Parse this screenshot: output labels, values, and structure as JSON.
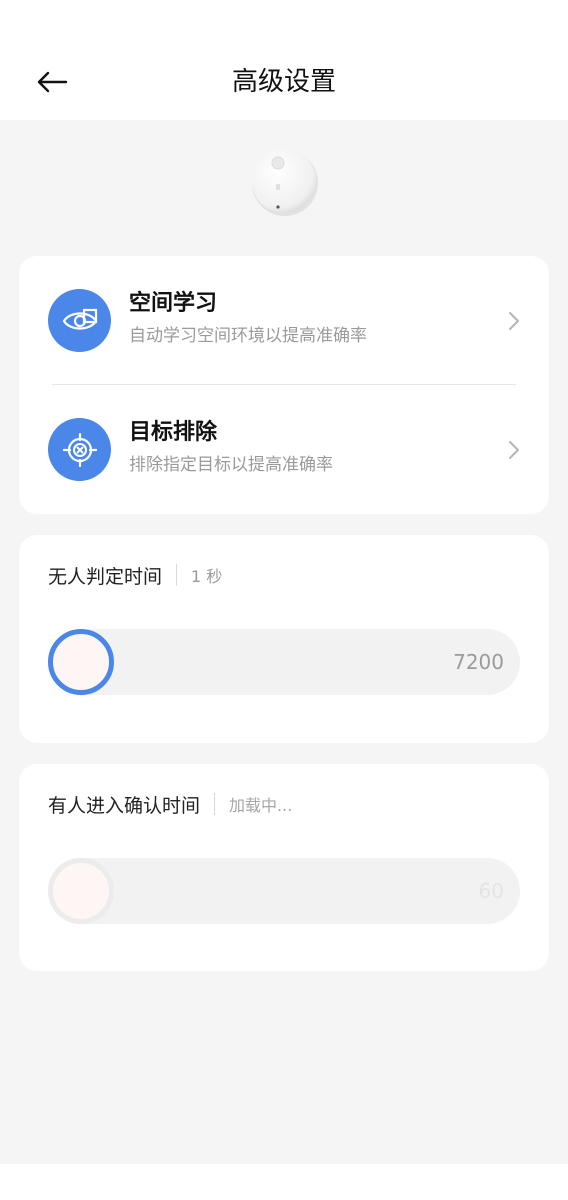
{
  "header": {
    "title": "高级设置"
  },
  "menu": [
    {
      "title": "空间学习",
      "subtitle": "自动学习空间环境以提高准确率",
      "icon": "eye-scan-icon"
    },
    {
      "title": "目标排除",
      "subtitle": "排除指定目标以提高准确率",
      "icon": "target-exclude-icon"
    }
  ],
  "no_person_time": {
    "label": "无人判定时间",
    "value": "1 秒",
    "max_label": "7200"
  },
  "person_enter_time": {
    "label": "有人进入确认时间",
    "value": "加载中...",
    "max_label": "60"
  },
  "colors": {
    "accent": "#4b87e9",
    "background": "#f5f5f5",
    "card": "#ffffff"
  }
}
